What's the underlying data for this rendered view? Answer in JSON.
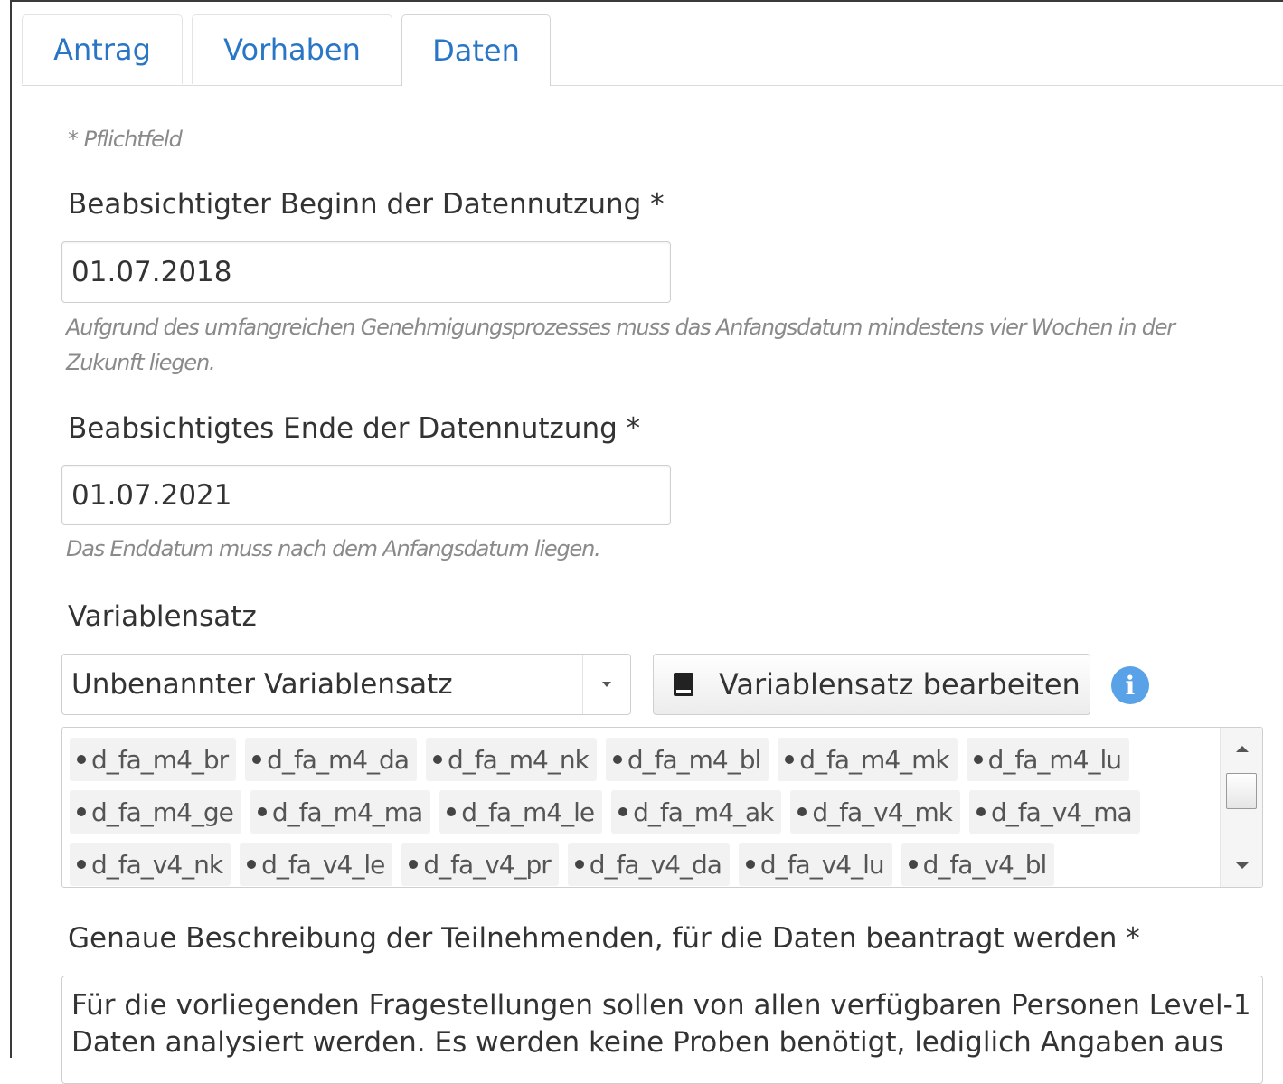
{
  "tabs": [
    {
      "label": "Antrag"
    },
    {
      "label": "Vorhaben"
    },
    {
      "label": "Daten"
    }
  ],
  "active_tab": "Daten",
  "required_note": "* Pflichtfeld",
  "start": {
    "label": "Beabsichtigter Beginn der Datennutzung *",
    "value": "01.07.2018",
    "help": "Aufgrund des umfangreichen Genehmigungsprozesses muss das Anfangsdatum mindestens vier Wochen in der Zukunft liegen."
  },
  "end": {
    "label": "Beabsichtigtes Ende der Datennutzung *",
    "value": "01.07.2021",
    "help": "Das Enddatum muss nach dem Anfangsdatum liegen."
  },
  "variableset": {
    "label": "Variablensatz",
    "selected": "Unbenannter Variablensatz",
    "edit_label": "Variablensatz bearbeiten",
    "info_symbol": "i",
    "rows": [
      [
        "d_fa_m4_br",
        "d_fa_m4_da",
        "d_fa_m4_nk",
        "d_fa_m4_bl",
        "d_fa_m4_mk",
        "d_fa_m4_lu"
      ],
      [
        "d_fa_m4_ge",
        "d_fa_m4_ma",
        "d_fa_m4_le",
        "d_fa_m4_ak",
        "d_fa_v4_mk",
        "d_fa_v4_ma"
      ],
      [
        "d_fa_v4_nk",
        "d_fa_v4_le",
        "d_fa_v4_pr",
        "d_fa_v4_da",
        "d_fa_v4_lu",
        "d_fa_v4_bl"
      ]
    ]
  },
  "participants": {
    "label": "Genaue Beschreibung der Teilnehmenden, für die Daten beantragt werden *",
    "text": "Für die vorliegenden Fragestellungen sollen von allen verfügbaren Personen Level-1 Daten analysiert werden. Es werden keine Proben benötigt, lediglich Angaben aus"
  },
  "icons": {
    "book": "book-icon",
    "info": "info-icon",
    "caret": "caret-down-icon"
  },
  "colors": {
    "link": "#2a76c6",
    "info": "#5aa2e8",
    "muted": "#8a8a8a"
  }
}
